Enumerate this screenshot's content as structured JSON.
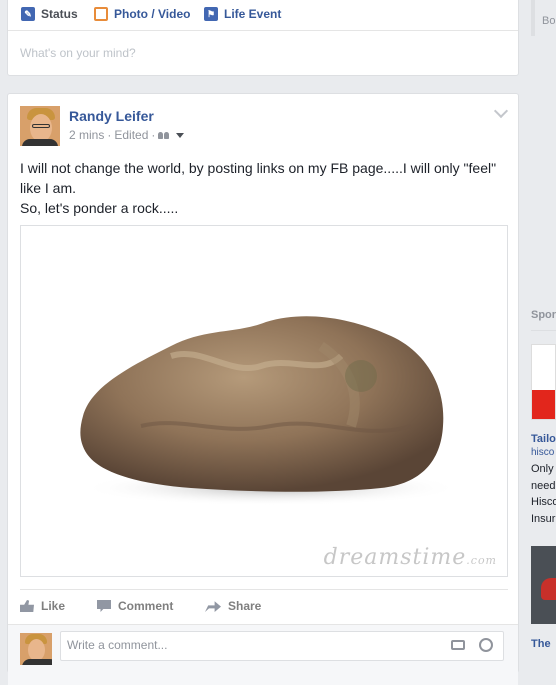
{
  "composer": {
    "tabs": [
      {
        "label": "Status",
        "icon": "pencil-icon"
      },
      {
        "label": "Photo / Video",
        "icon": "photo-icon"
      },
      {
        "label": "Life Event",
        "icon": "flag-icon"
      }
    ],
    "placeholder": "What's on your mind?"
  },
  "post": {
    "author": "Randy Leifer",
    "time": "2 mins",
    "edited": "Edited",
    "separator": "·",
    "audience_icon": "friends-icon",
    "text_lines": [
      "I will not change the world, by posting links on my FB page.....I will only \"feel\"",
      "like I am.",
      "So, let's ponder a rock....."
    ],
    "watermark": "dreamstime",
    "watermark_suffix": ".com",
    "actions": [
      {
        "label": "Like",
        "icon": "thumbs-up-icon"
      },
      {
        "label": "Comment",
        "icon": "comment-icon"
      },
      {
        "label": "Share",
        "icon": "share-icon"
      }
    ],
    "comment_placeholder": "Write a comment..."
  },
  "right_column": {
    "top_text": "Bo",
    "sponsored": "Spor",
    "ad1_title": "Tailo",
    "ad1_domain": "hisco",
    "ad1_lines": [
      "Only",
      "need",
      "Hisco",
      "Insur"
    ],
    "ad2_title": "The"
  },
  "colors": {
    "link": "#365899",
    "background": "#e9ebee",
    "ad_red": "#e2261c"
  }
}
